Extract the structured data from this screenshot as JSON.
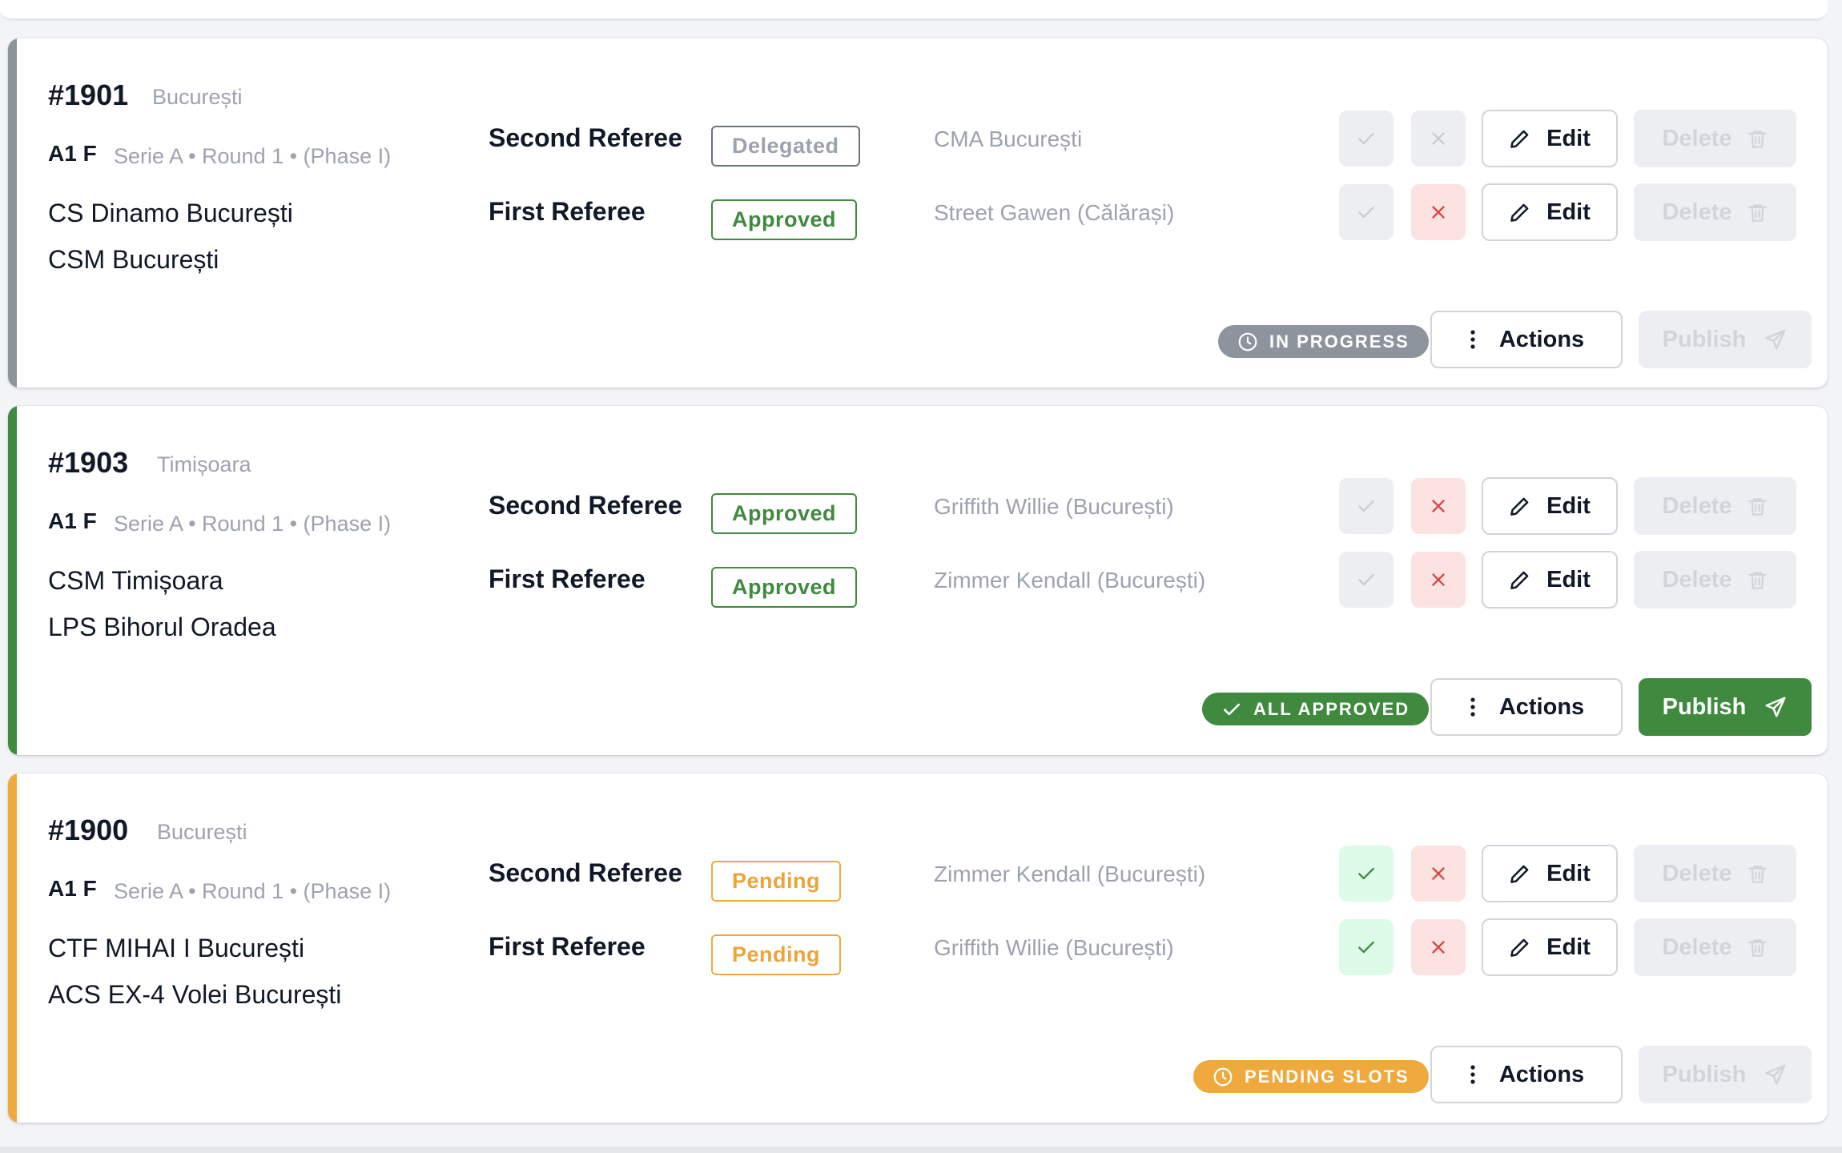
{
  "colors": {
    "gray_accent": "#8e949d",
    "green_accent": "#3f8a3f",
    "orange_accent": "#f0a93c",
    "danger": "#d84a4a",
    "muted": "#9ca3af"
  },
  "common": {
    "edit_label": "Edit",
    "delete_label": "Delete",
    "actions_label": "Actions",
    "publish_label": "Publish",
    "second_referee_label": "Second Referee",
    "first_referee_label": "First Referee"
  },
  "matches": [
    {
      "id": "#1901",
      "city": "București",
      "league": "A1 F",
      "meta": "Serie A • Round 1 • (Phase I)",
      "home": "CS Dinamo București",
      "away": "CSM București",
      "second_status": "Delegated",
      "second_name": "CMA București",
      "first_status": "Approved",
      "first_name": "Street Gawen (Călărași)",
      "state": "IN PROGRESS"
    },
    {
      "id": "#1903",
      "city": "Timișoara",
      "league": "A1 F",
      "meta": "Serie A • Round 1 • (Phase I)",
      "home": "CSM Timișoara",
      "away": "LPS Bihorul Oradea",
      "second_status": "Approved",
      "second_name": "Griffith Willie (București)",
      "first_status": "Approved",
      "first_name": "Zimmer Kendall (București)",
      "state": "ALL APPROVED"
    },
    {
      "id": "#1900",
      "city": "București",
      "league": "A1 F",
      "meta": "Serie A • Round 1 • (Phase I)",
      "home": "CTF MIHAI I București",
      "away": "ACS EX-4 Volei București",
      "second_status": "Pending",
      "second_name": "Zimmer Kendall (București)",
      "first_status": "Pending",
      "first_name": "Griffith Willie (București)",
      "state": "PENDING SLOTS"
    }
  ]
}
